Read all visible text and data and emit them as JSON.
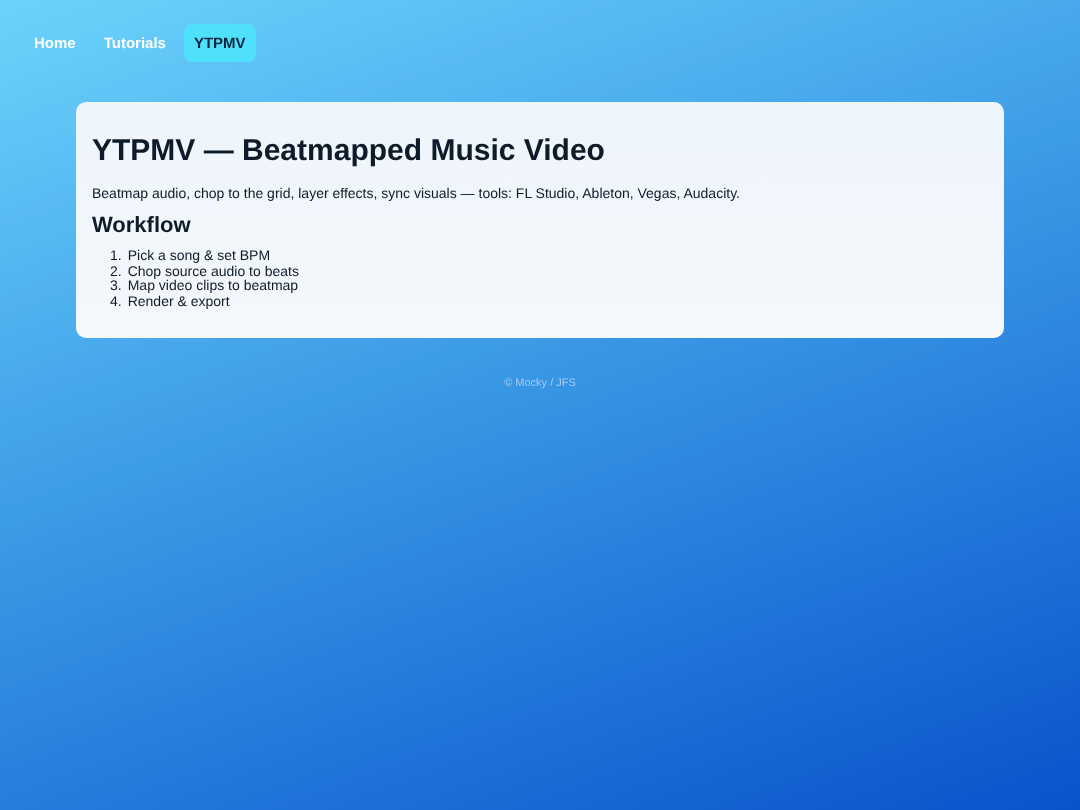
{
  "nav": [
    {
      "label": "Home",
      "selected": false
    },
    {
      "label": "Tutorials",
      "selected": false
    },
    {
      "label": "YTPMV",
      "selected": true
    }
  ],
  "card": {
    "title": "YTPMV — Beatmapped Music Video",
    "description": "Beatmap audio, chop to the grid, layer effects, sync visuals — tools: FL Studio, Ableton, Vegas, Audacity.",
    "section_title": "Workflow",
    "steps": [
      {
        "number": "1.",
        "text": "Pick a song & set BPM"
      },
      {
        "number": "2.",
        "text": "Chop source audio to beats"
      },
      {
        "number": "3.",
        "text": "Map video clips to beatmap"
      },
      {
        "number": "4.",
        "text": "Render & export"
      }
    ]
  },
  "footer": "© Mocky / JFS"
}
